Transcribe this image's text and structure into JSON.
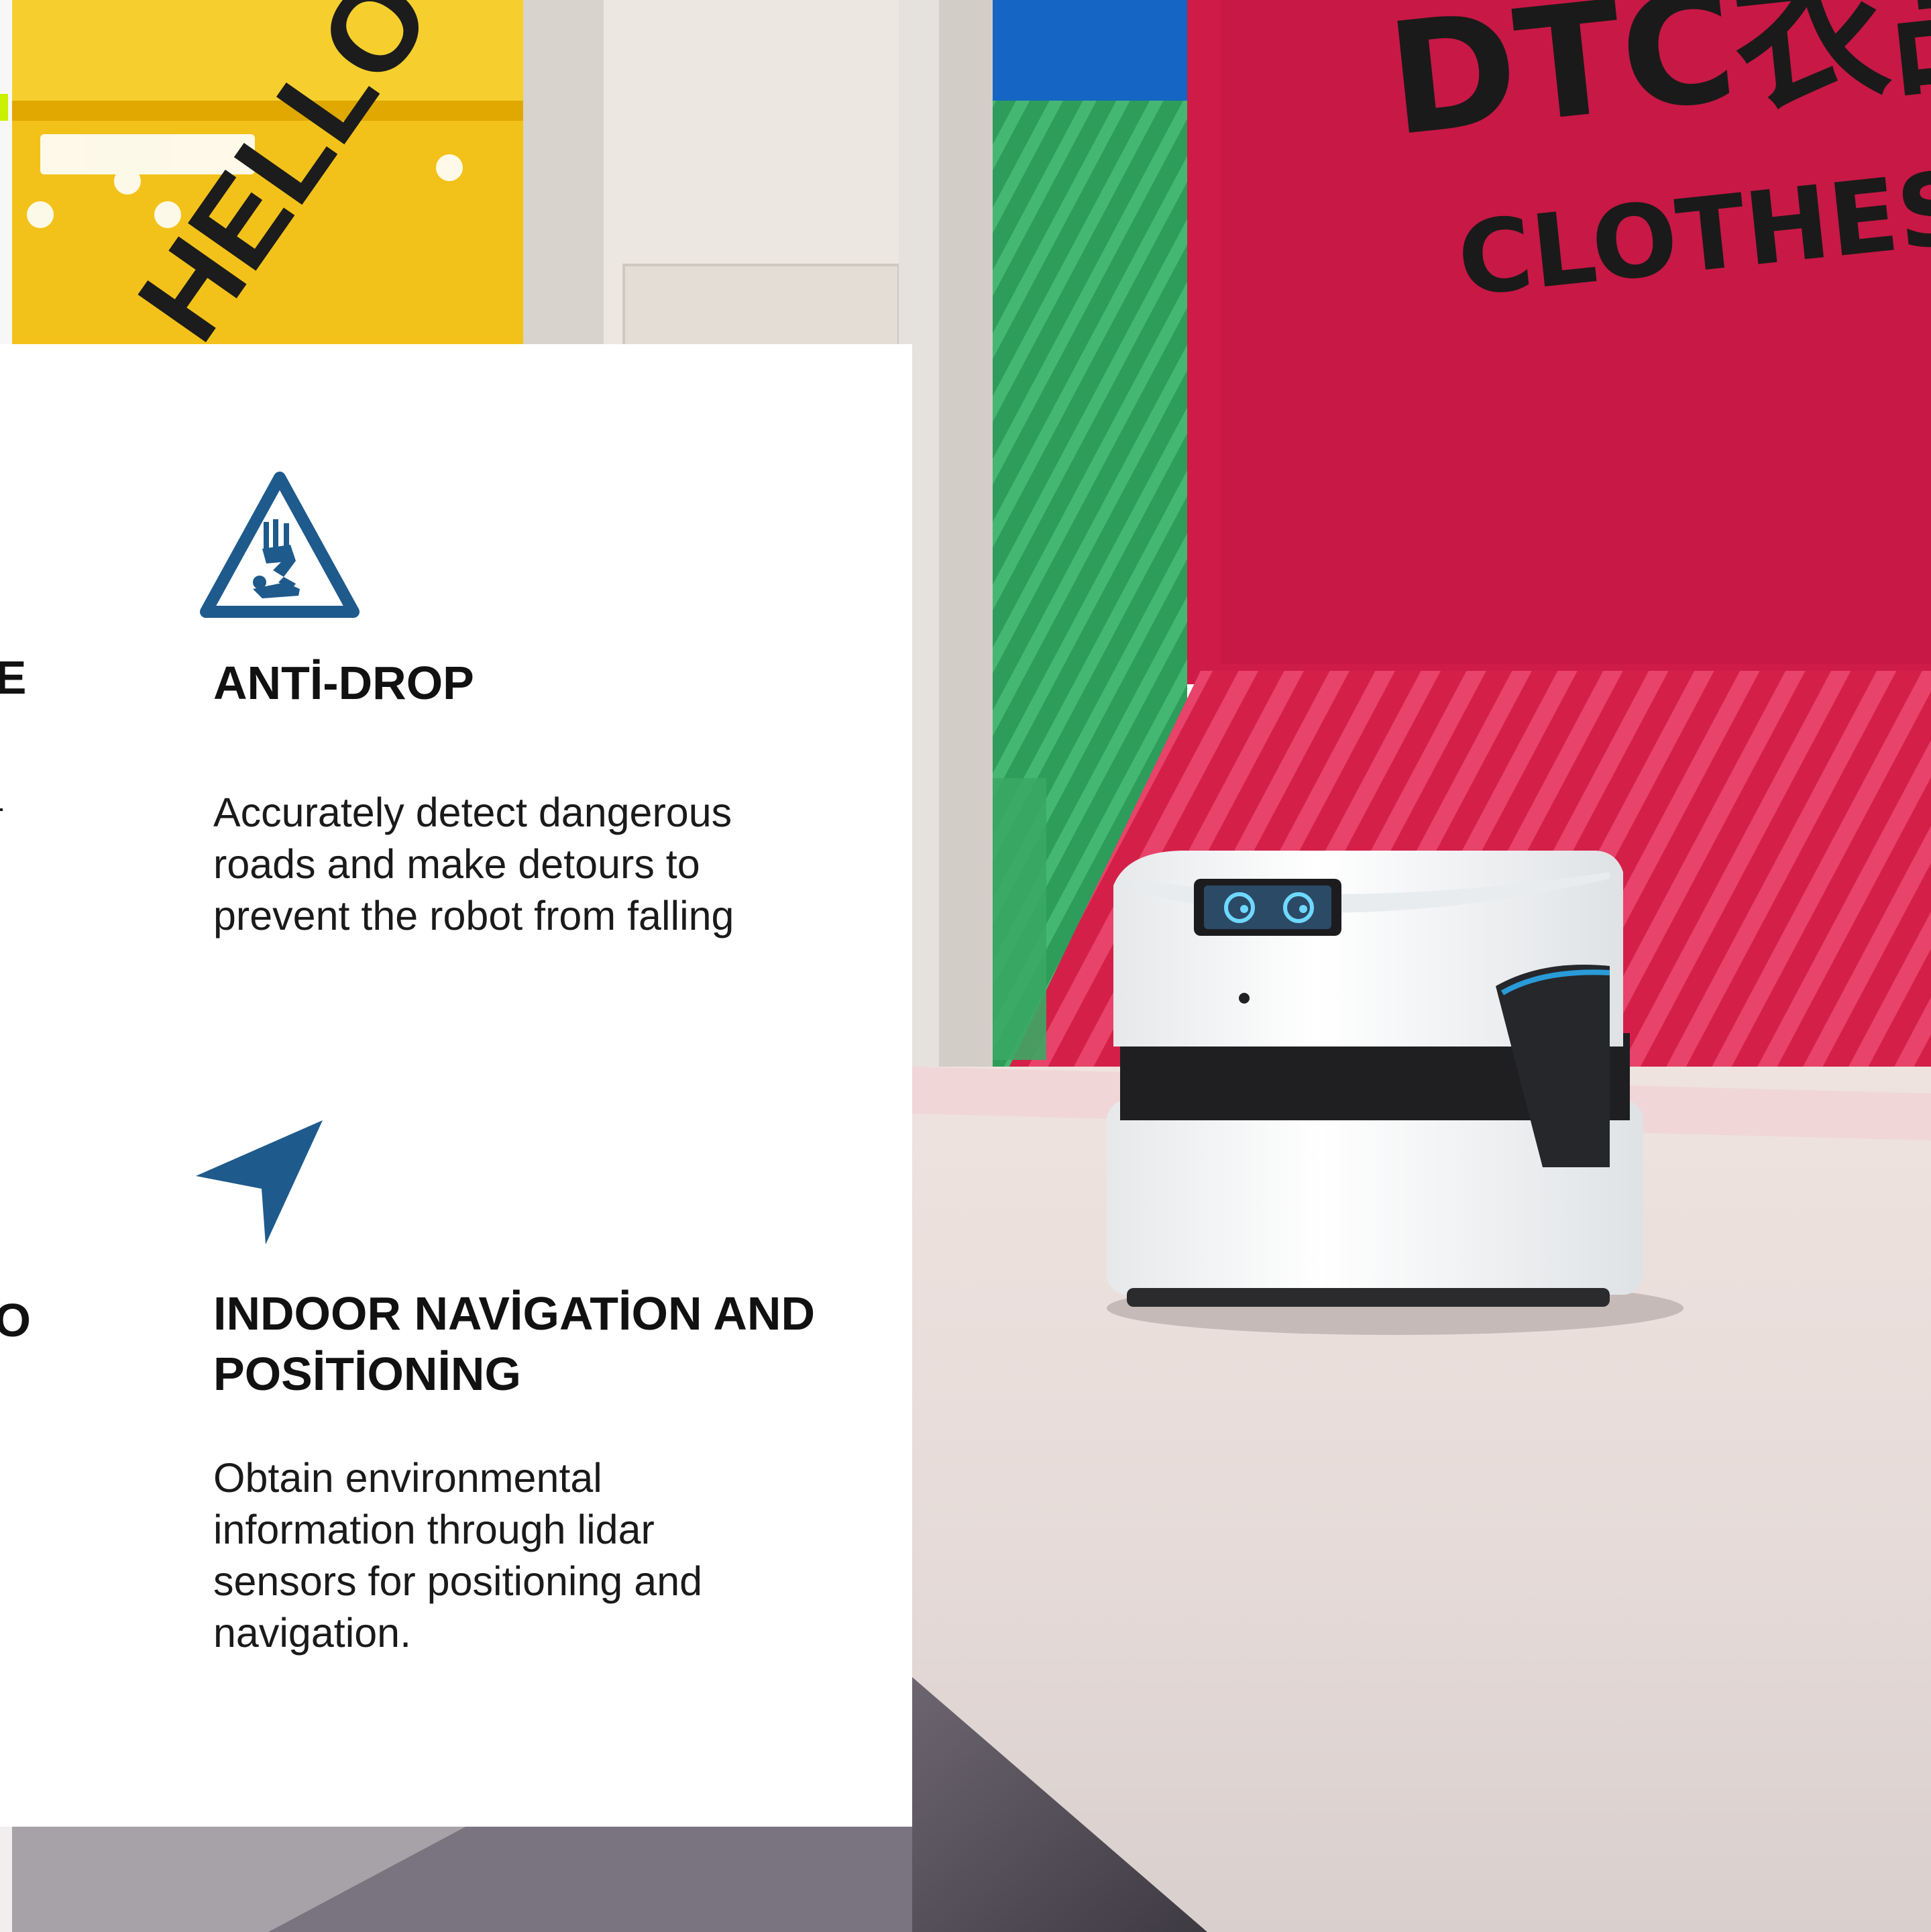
{
  "colors": {
    "icon_blue": "#1e5a8c",
    "text_dark": "#111111",
    "card_bg": "#ffffff",
    "wall_pink": "#d81f4f",
    "stripe_green": "#2fa35f",
    "mall_yellow": "#f5c400"
  },
  "background": {
    "sign_line_1": "DTC衣品",
    "sign_line_2": "CLOTHES",
    "store_sign": "HELLO"
  },
  "left_column": {
    "cut_title_1": "LE",
    "cut_title_2": "TO"
  },
  "features": [
    {
      "icon": "warning-fall-icon",
      "title": "ANTİ-DROP",
      "desc_lines": [
        "Accurately detect dangerous",
        "roads and make detours to",
        "prevent the robot from falling"
      ]
    },
    {
      "icon": "navigation-arrow-icon",
      "title_lines": [
        "INDOOR NAVİGATİON AND",
        "POSİTİONİNG"
      ],
      "desc_lines": [
        "Obtain environmental",
        "information through lidar",
        "sensors for positioning and",
        "navigation."
      ]
    }
  ]
}
